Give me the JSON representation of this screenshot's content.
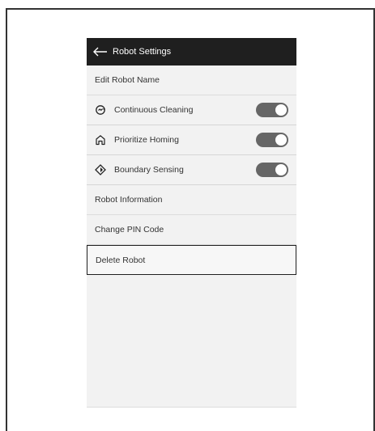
{
  "header": {
    "title": "Robot Settings"
  },
  "items": {
    "edit_name": "Edit Robot Name",
    "continuous_cleaning": "Continuous Cleaning",
    "prioritize_homing": "Prioritize Homing",
    "boundary_sensing": "Boundary Sensing",
    "robot_information": "Robot Information",
    "change_pin": "Change PIN Code",
    "delete_robot": "Delete Robot"
  },
  "toggles": {
    "continuous_cleaning": true,
    "prioritize_homing": true,
    "boundary_sensing": true
  },
  "icons": {
    "back": "arrow-left-icon",
    "continuous_cleaning": "cycle-icon",
    "prioritize_homing": "home-icon",
    "boundary_sensing": "boundary-diamond-icon"
  },
  "colors": {
    "header_bg": "#1f1f1f",
    "toggle_on": "#666666",
    "screen_bg": "#f2f2f2"
  }
}
